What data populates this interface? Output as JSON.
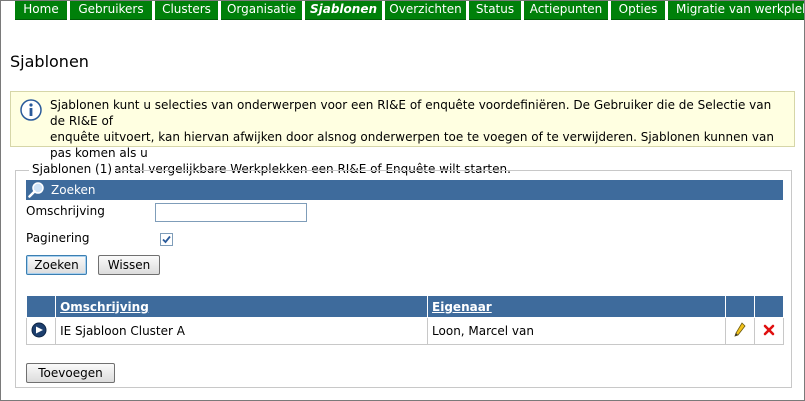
{
  "nav": {
    "items": [
      {
        "label": "Home",
        "active": false
      },
      {
        "label": "Gebruikers",
        "active": false
      },
      {
        "label": "Clusters",
        "active": false
      },
      {
        "label": "Organisatie",
        "active": false
      },
      {
        "label": "Sjablonen",
        "active": true
      },
      {
        "label": "Overzichten",
        "active": false
      },
      {
        "label": "Status",
        "active": false
      },
      {
        "label": "Actiepunten",
        "active": false
      },
      {
        "label": "Opties",
        "active": false
      },
      {
        "label": "Migratie van werkplekken",
        "active": false
      }
    ]
  },
  "page": {
    "title": "Sjablonen"
  },
  "info": {
    "line1": "Sjablonen kunt u selecties van onderwerpen voor een RI&E of enquête voordefiniëren. De Gebruiker die de Selectie van de RI&E of",
    "line2": "enquête uitvoert, kan hiervan afwijken door alsnog onderwerpen toe te voegen of te verwijderen. Sjablonen kunnen van pas komen als u",
    "line3": "voor een aantal vergelijkbare Werkplekken een RI&E of Enquête wilt starten."
  },
  "fieldset": {
    "legend": "Sjablonen (1)"
  },
  "search": {
    "header": "Zoeken",
    "omschrijving_label": "Omschrijving",
    "omschrijving_value": "",
    "paginering_label": "Paginering",
    "paginering_checked": true,
    "search_button": "Zoeken",
    "clear_button": "Wissen"
  },
  "grid": {
    "headers": {
      "omschrijving": "Omschrijving",
      "eigenaar": "Eigenaar"
    },
    "rows": [
      {
        "omschrijving": "IE Sjabloon Cluster A",
        "eigenaar": "Loon, Marcel van"
      }
    ]
  },
  "actions": {
    "add_button": "Toevoegen"
  },
  "colors": {
    "nav_green": "#00800a",
    "header_blue": "#3e6b9c",
    "info_bg": "#ffffe1"
  }
}
